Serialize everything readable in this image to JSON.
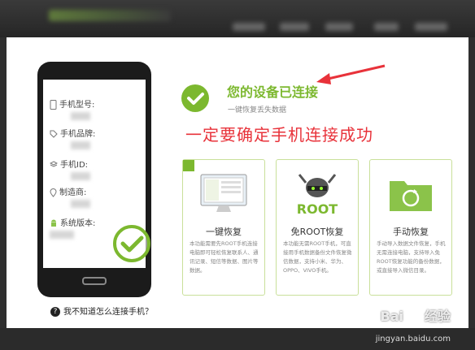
{
  "status": {
    "title": "您的设备已连接",
    "subtitle": "一键恢复丢失数据"
  },
  "annotation": "一定要确定手机连接成功",
  "phone": {
    "rows": [
      {
        "label": "手机型号:"
      },
      {
        "label": "手机品牌:"
      },
      {
        "label": "手机ID:"
      },
      {
        "label": "制造商:"
      },
      {
        "label": "系统版本:"
      }
    ]
  },
  "help": {
    "text": "我不知道怎么连接手机？"
  },
  "cards": [
    {
      "title": "一键恢复",
      "desc": "本功能需要先ROOT手机连接电脑即可轻松恢复联系人、通讯记录、短信等数据、图片等数据。",
      "icon": "monitor-icon"
    },
    {
      "title": "免ROOT恢复",
      "desc": "本功能无需ROOT手机，可直接用手机数据备份文件恢复微信数据，支持小米、华为、OPPO、VIVO手机。",
      "icon": "root-android-icon",
      "badge": "ROOT"
    },
    {
      "title": "手动恢复",
      "desc": "手动导入数据文件恢复，手机无需连接电脑，支持导入免ROOT恢复功能的备份数据，或直接导入微信目录。",
      "icon": "folder-refresh-icon"
    }
  ],
  "watermark": {
    "brand_left": "Bai",
    "brand_right": "经验",
    "url": "jingyan.baidu.com"
  },
  "colors": {
    "accent": "#7cb82f",
    "annotation": "#e8323a",
    "arrow": "#e8323a"
  }
}
